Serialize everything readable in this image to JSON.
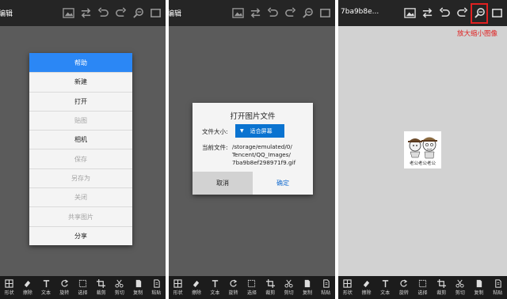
{
  "panels": [
    {
      "title": "编辑"
    },
    {
      "title": "编辑"
    },
    {
      "title": "7ba9b8e..."
    }
  ],
  "toolbar_icons": [
    "image-icon",
    "swap-icon",
    "undo-icon",
    "redo-icon",
    "zoom-icon",
    "fullscreen-icon"
  ],
  "bottom_tools": [
    {
      "icon": "grid-icon",
      "label": "形状"
    },
    {
      "icon": "eraser-icon",
      "label": "擦除"
    },
    {
      "icon": "text-icon",
      "label": "文本"
    },
    {
      "icon": "rotate-icon",
      "label": "旋转"
    },
    {
      "icon": "select-icon",
      "label": "选择"
    },
    {
      "icon": "crop-icon",
      "label": "裁剪"
    },
    {
      "icon": "scissors-icon",
      "label": "剪切"
    },
    {
      "icon": "copy-icon",
      "label": "复制"
    },
    {
      "icon": "paste-icon",
      "label": "粘贴"
    }
  ],
  "menu": {
    "items": [
      {
        "label": "帮助",
        "state": "header"
      },
      {
        "label": "新建",
        "state": "enabled"
      },
      {
        "label": "打开",
        "state": "enabled"
      },
      {
        "label": "贴图",
        "state": "disabled"
      },
      {
        "label": "相机",
        "state": "enabled"
      },
      {
        "label": "保存",
        "state": "disabled"
      },
      {
        "label": "另存为",
        "state": "disabled"
      },
      {
        "label": "关闭",
        "state": "disabled"
      },
      {
        "label": "共享图片",
        "state": "disabled"
      },
      {
        "label": "分享",
        "state": "enabled"
      }
    ]
  },
  "dialog": {
    "title": "打开图片文件",
    "size_label": "文件大小:",
    "size_value": "适合屏幕",
    "file_label": "当前文件:",
    "file_path_1": "/storage/emulated/0/",
    "file_path_2": "Tencent/QQ_Images/",
    "file_path_3": "7ba9b8ef298971f9.gif",
    "cancel": "取消",
    "ok": "确定"
  },
  "image": {
    "caption": "老公老公老公"
  },
  "annotation": "放大缩小图像",
  "colors": {
    "accent_blue": "#2b87f5",
    "select_blue": "#0a73d0",
    "highlight_red": "#e02020",
    "topbar": "#252525",
    "bottombar": "#1c1c1c"
  }
}
